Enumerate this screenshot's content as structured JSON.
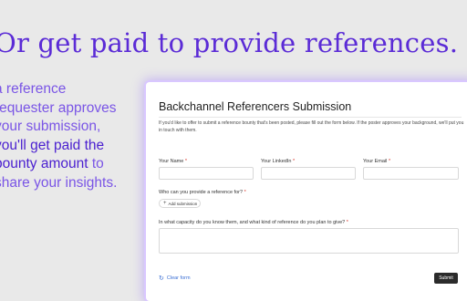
{
  "hero": {
    "headline": "Or get paid to provide references.",
    "lines": [
      {
        "text": "a reference",
        "highlight": false
      },
      {
        "text": "requester approves",
        "highlight": false
      },
      {
        "text": "your submission,",
        "highlight": false
      },
      {
        "text": "you'll get paid the",
        "highlight": true
      },
      {
        "text": "bounty amount",
        "highlight": true,
        "suffix": " to"
      },
      {
        "text": "share your insights.",
        "highlight": false
      }
    ]
  },
  "form": {
    "title": "Backchannel Referencers Submission",
    "description": "If you'd like to offer to submit a reference bounty that's been posted, please fill out the form below. If the poster approves your background, we'll put you in touch with them.",
    "required_mark": "*",
    "fields": {
      "name_label": "Your Name",
      "linkedin_label": "Your LinkedIn",
      "email_label": "Your Email",
      "reference_for_label": "Who can you provide a reference for?",
      "capacity_label": "In what capacity do you know them, and what kind of reference do you plan to give?"
    },
    "add_submission_label": "Add submission",
    "clear_label": "Clear form",
    "submit_label": "Submit"
  }
}
